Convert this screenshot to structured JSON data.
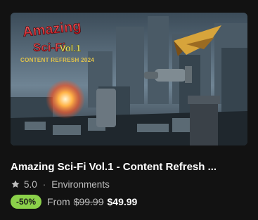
{
  "card": {
    "thumbnail": {
      "logo_line1": "Amazing",
      "logo_line2": "Sci-Fi",
      "logo_vol": "Vol.1",
      "logo_line3": "CONTENT REFRESH 2024"
    },
    "title": "Amazing Sci-Fi Vol.1 - Content Refresh ...",
    "rating": "5.0",
    "separator": "·",
    "category": "Environments",
    "discount_badge": "-50%",
    "price_prefix": "From",
    "original_price": "$99.99",
    "sale_price": "$49.99"
  },
  "colors": {
    "background": "#121212",
    "badge": "#8bd14a",
    "title": "#ffffff",
    "muted_text": "#bdbdbd"
  },
  "icons": {
    "rating": "star-icon"
  }
}
